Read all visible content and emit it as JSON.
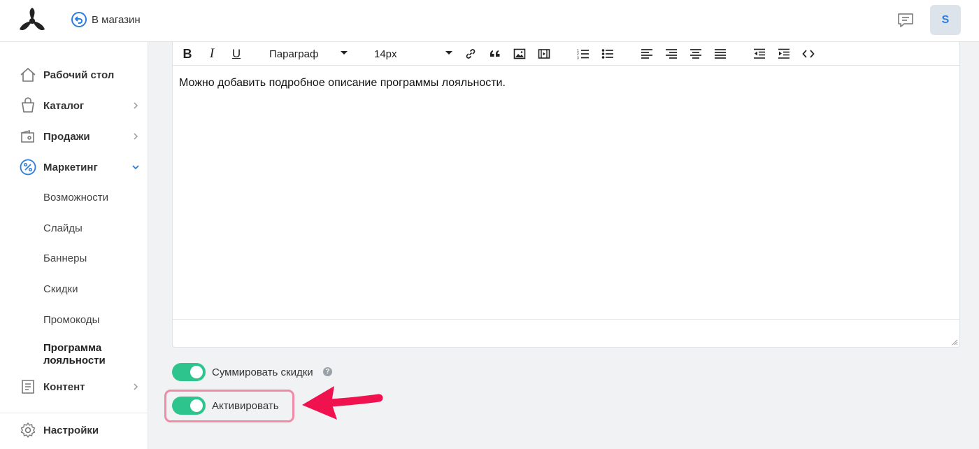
{
  "header": {
    "back_link_label": "В магазин",
    "avatar_letter": "S",
    "accent_color": "#2b7de0"
  },
  "sidebar": {
    "items": [
      {
        "label": "Рабочий стол",
        "icon": "home-icon"
      },
      {
        "label": "Каталог",
        "icon": "bag-icon"
      },
      {
        "label": "Продажи",
        "icon": "sales-icon"
      },
      {
        "label": "Маркетинг",
        "icon": "percent-icon"
      },
      {
        "label": "Контент",
        "icon": "document-icon"
      }
    ],
    "marketing_sub": [
      "Возможности",
      "Слайды",
      "Баннеры",
      "Скидки",
      "Промокоды",
      "Программа лояльности"
    ],
    "settings_label": "Настройки"
  },
  "editor": {
    "paragraph_select": "Параграф",
    "font_size_select": "14px",
    "content": "Можно добавить подробное описание программы лояльности."
  },
  "toggles": [
    {
      "label": "Суммировать скидки",
      "on": true
    },
    {
      "label": "Активировать",
      "on": true
    }
  ],
  "colors": {
    "toggle_on": "#2dc48d",
    "highlight_border": "#f08aa5",
    "arrow": "#f0124f"
  }
}
